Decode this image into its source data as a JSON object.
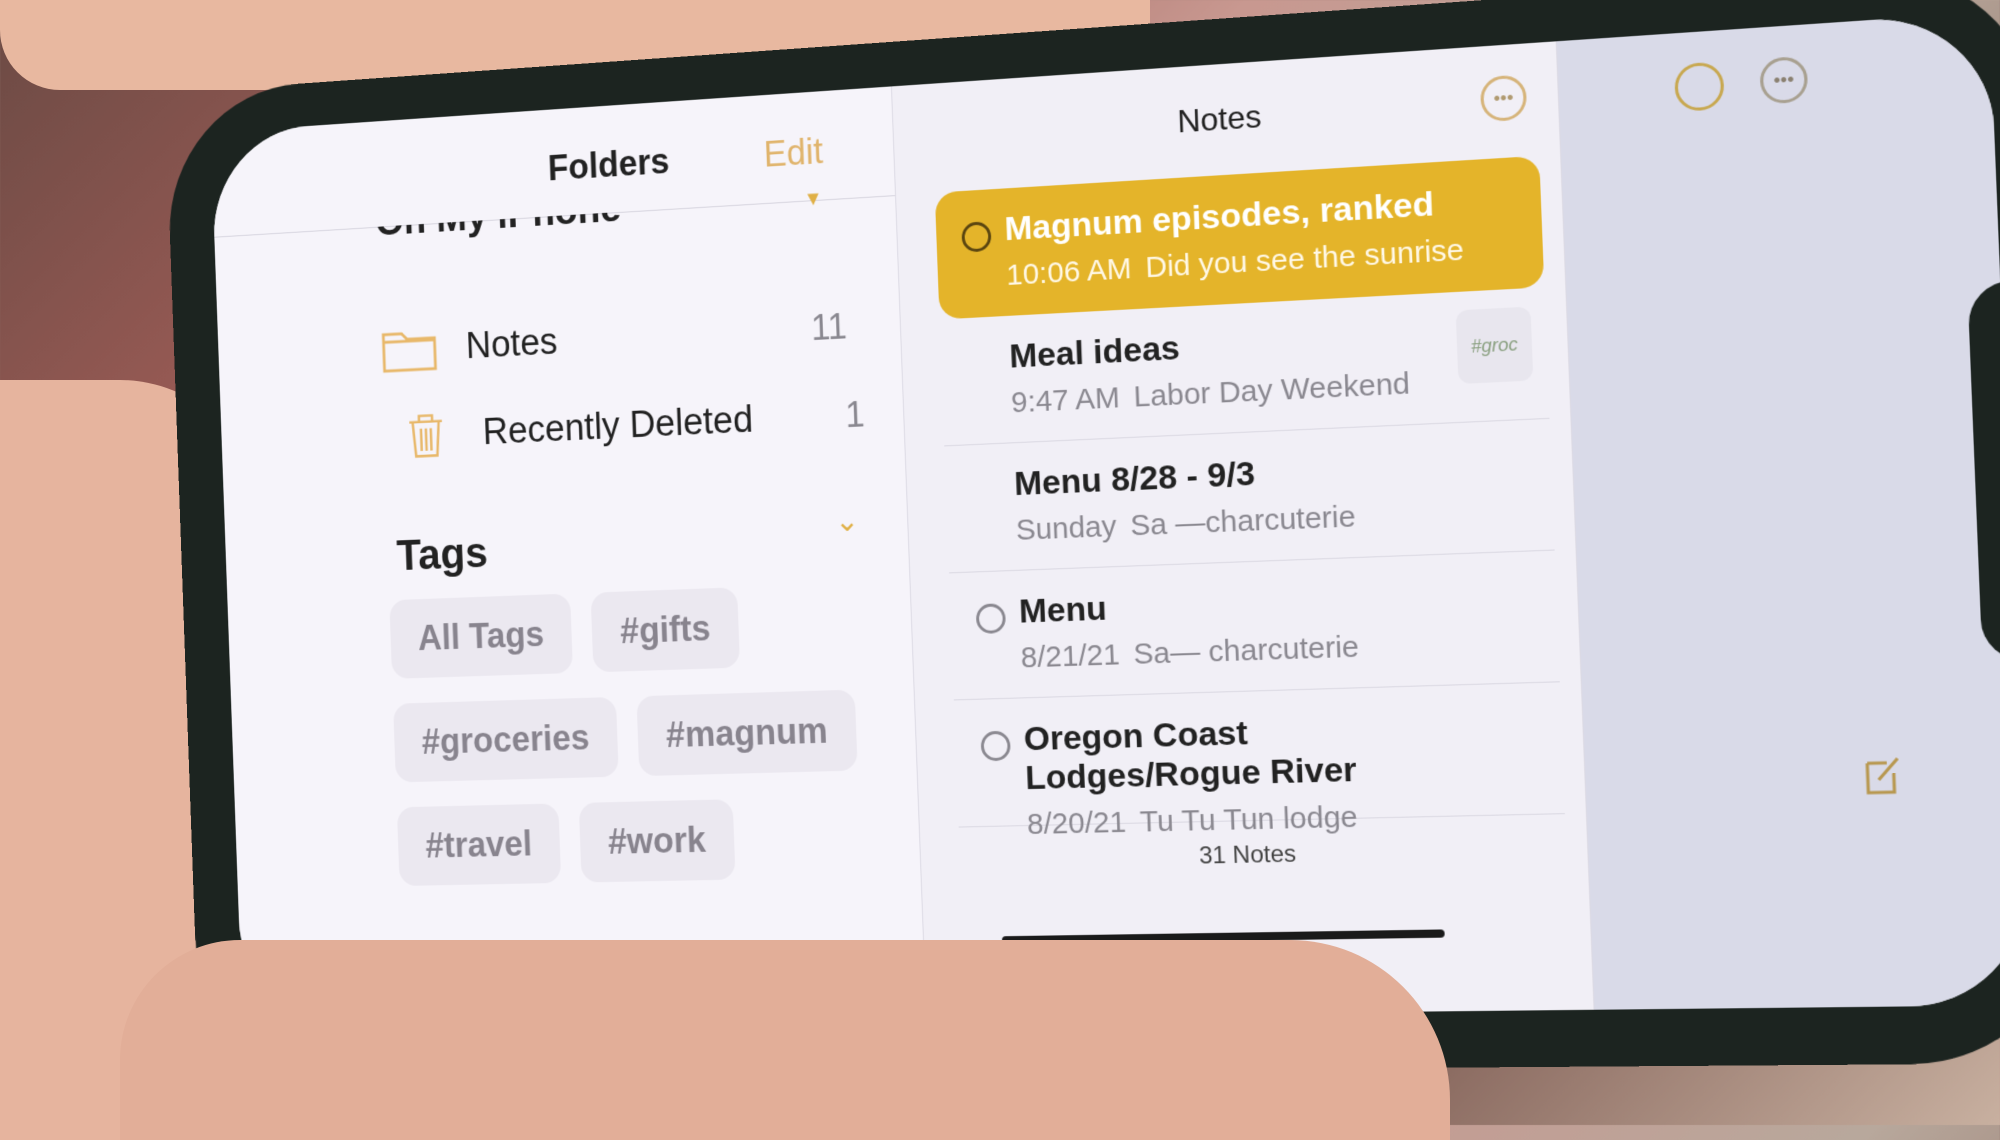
{
  "sidebar": {
    "title": "Folders",
    "edit_label": "Edit",
    "section_label": "On My iPhone",
    "folders": [
      {
        "name": "Notes",
        "count": "11",
        "icon": "folder-icon"
      },
      {
        "name": "Recently Deleted",
        "count": "1",
        "icon": "trash-icon"
      }
    ],
    "tags_title": "Tags",
    "tags": [
      "All Tags",
      "#gifts",
      "#groceries",
      "#magnum",
      "#travel",
      "#work"
    ],
    "new_folder_icon": "new-folder-icon"
  },
  "list": {
    "title": "Notes",
    "more_icon": "ellipsis-circle-icon",
    "notes": [
      {
        "title": "Magnum episodes, ranked",
        "date": "10:06 AM",
        "snippet": "Did you see the sunrise",
        "shared": true,
        "selected": true
      },
      {
        "title": "Meal ideas",
        "date": "9:47 AM",
        "snippet": "Labor Day Weekend",
        "shared": false,
        "thumbnail": "#groc"
      },
      {
        "title": "Menu 8/28 - 9/3",
        "date": "Sunday",
        "snippet": "Sa —charcuterie",
        "shared": false
      },
      {
        "title": "Menu",
        "date": "8/21/21",
        "snippet": "Sa— charcuterie",
        "shared": true
      },
      {
        "title": "Oregon Coast Lodges/Rogue River",
        "date": "8/20/21",
        "snippet": "Tu Tu Tun lodge",
        "shared": true
      }
    ],
    "count_label": "31 Notes"
  },
  "detail": {
    "collab_icon": "collaborators-icon",
    "more_icon": "ellipsis-circle-icon",
    "compose_icon": "compose-icon"
  },
  "colors": {
    "accent": "#E4B42A",
    "accent_light": "#E0B46C"
  }
}
